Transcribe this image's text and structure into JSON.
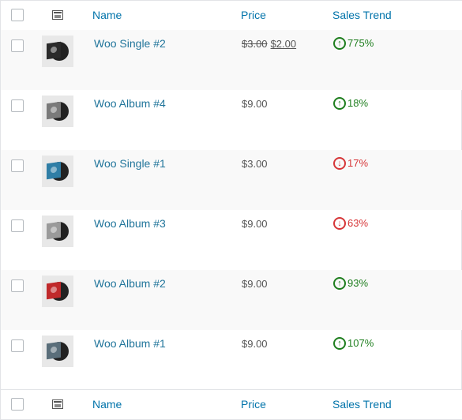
{
  "header": {
    "name": "Name",
    "price": "Price",
    "sales_trend": "Sales Trend"
  },
  "footer": {
    "name": "Name",
    "price": "Price",
    "sales_trend": "Sales Trend"
  },
  "products": [
    {
      "name": "Woo Single #2",
      "price_old": "$3.00",
      "price": "$2.00",
      "trend": "775%",
      "trend_dir": "up",
      "sleeve": "#2a2a2a",
      "icon": "vinyl-thumbnail-icon"
    },
    {
      "name": "Woo Album #4",
      "price_old": "",
      "price": "$9.00",
      "trend": "18%",
      "trend_dir": "up",
      "sleeve": "#7a7a7a",
      "icon": "vinyl-thumbnail-icon"
    },
    {
      "name": "Woo Single #1",
      "price_old": "",
      "price": "$3.00",
      "trend": "17%",
      "trend_dir": "down",
      "sleeve": "#2f7ea6",
      "icon": "vinyl-thumbnail-icon"
    },
    {
      "name": "Woo Album #3",
      "price_old": "",
      "price": "$9.00",
      "trend": "63%",
      "trend_dir": "down",
      "sleeve": "#9a9a9a",
      "icon": "vinyl-thumbnail-icon"
    },
    {
      "name": "Woo Album #2",
      "price_old": "",
      "price": "$9.00",
      "trend": "93%",
      "trend_dir": "up",
      "sleeve": "#c0292b",
      "icon": "vinyl-thumbnail-icon"
    },
    {
      "name": "Woo Album #1",
      "price_old": "",
      "price": "$9.00",
      "trend": "107%",
      "trend_dir": "up",
      "sleeve": "#5a6e7a",
      "icon": "vinyl-thumbnail-icon"
    }
  ],
  "colors": {
    "up": "#1e7e1e",
    "down": "#d63638",
    "link": "#21759b"
  }
}
